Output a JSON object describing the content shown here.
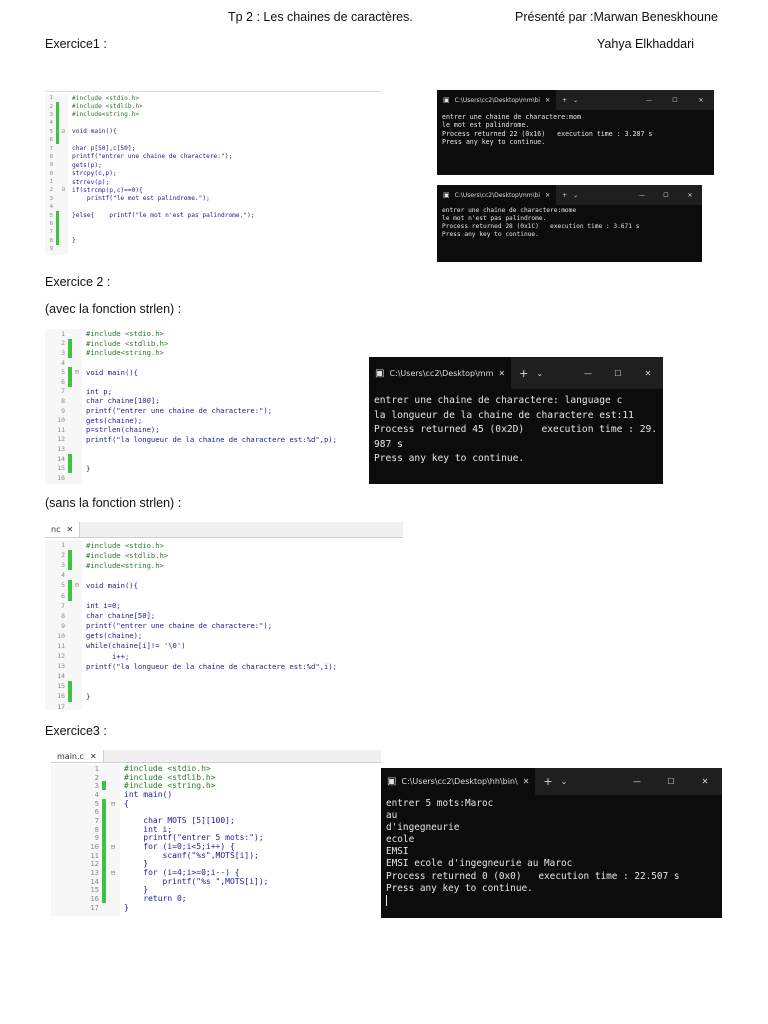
{
  "header": {
    "title": "Tp 2 : Les chaines de caractères.",
    "presented_by": "Présenté par :Marwan Beneskhoune",
    "second_author": "Yahya Elkhaddari"
  },
  "sections": {
    "ex1": "Exercice1 :",
    "ex2": "Exercice 2 :",
    "ex2_with": "(avec la fonction strlen) :",
    "ex2_without": "(sans la fonction strlen) :",
    "ex3": "Exercice3 :"
  },
  "editors": {
    "ex1": {
      "lines": [
        {
          "n": "1",
          "code": "#include <stdio.h>",
          "pp": true,
          "bar": false,
          "fold": ""
        },
        {
          "n": "2",
          "code": "#include <stdlib.h>",
          "pp": true,
          "bar": true,
          "fold": ""
        },
        {
          "n": "3",
          "code": "#include<string.h>",
          "pp": true,
          "bar": true,
          "fold": ""
        },
        {
          "n": "4",
          "code": "",
          "bar": true,
          "fold": ""
        },
        {
          "n": "5",
          "code": "void main(){",
          "bar": true,
          "fold": "⊟"
        },
        {
          "n": "6",
          "code": "",
          "bar": true,
          "fold": ""
        },
        {
          "n": "7",
          "code": "char p[50],c[50];",
          "bar": false,
          "fold": ""
        },
        {
          "n": "8",
          "code": "printf(\"entrer une chaine de charactere:\");",
          "bar": false,
          "fold": ""
        },
        {
          "n": "9",
          "code": "gets(p);",
          "bar": false,
          "fold": ""
        },
        {
          "n": "0",
          "code": "strcpy(c,p);",
          "bar": false,
          "fold": ""
        },
        {
          "n": "1",
          "code": "strrev(p);",
          "bar": false,
          "fold": ""
        },
        {
          "n": "2",
          "code": "if(strcmp(p,c)==0){",
          "bar": false,
          "fold": "⊟"
        },
        {
          "n": "3",
          "code": "    printf(\"le mot est palindrome.\");",
          "bar": false,
          "fold": ""
        },
        {
          "n": "4",
          "code": "",
          "bar": false,
          "fold": ""
        },
        {
          "n": "5",
          "code": "}else{    printf(\"le mot n'est pas palindrome.\");",
          "bar": true,
          "fold": ""
        },
        {
          "n": "6",
          "code": "",
          "bar": true,
          "fold": ""
        },
        {
          "n": "7",
          "code": "",
          "bar": true,
          "fold": ""
        },
        {
          "n": "8",
          "code": "}",
          "bar": true,
          "fold": ""
        },
        {
          "n": "9",
          "code": "",
          "bar": false,
          "fold": ""
        }
      ]
    },
    "ex2a": {
      "lines": [
        {
          "n": "1",
          "code": "#include <stdio.h>",
          "pp": true,
          "bar": false,
          "fold": ""
        },
        {
          "n": "2",
          "code": "#include <stdlib.h>",
          "pp": true,
          "bar": true,
          "fold": ""
        },
        {
          "n": "3",
          "code": "#include<string.h>",
          "pp": true,
          "bar": true,
          "fold": ""
        },
        {
          "n": "4",
          "code": "",
          "bar": false,
          "fold": ""
        },
        {
          "n": "5",
          "code": "void main(){",
          "bar": true,
          "fold": "⊟"
        },
        {
          "n": "6",
          "code": "",
          "bar": true,
          "fold": ""
        },
        {
          "n": "7",
          "code": "int p;",
          "bar": false,
          "fold": ""
        },
        {
          "n": "8",
          "code": "char chaine[100];",
          "bar": false,
          "fold": ""
        },
        {
          "n": "9",
          "code": "printf(\"entrer une chaine de charactere:\");",
          "bar": false,
          "fold": ""
        },
        {
          "n": "10",
          "code": "gets(chaine);",
          "bar": false,
          "fold": ""
        },
        {
          "n": "11",
          "code": "p=strlen(chaine);",
          "bar": false,
          "fold": ""
        },
        {
          "n": "12",
          "code": "printf(\"la longueur de la chaine de charactere est:%d\",p);",
          "bar": false,
          "fold": ""
        },
        {
          "n": "13",
          "code": "",
          "bar": false,
          "fold": ""
        },
        {
          "n": "14",
          "code": "",
          "bar": true,
          "fold": ""
        },
        {
          "n": "15",
          "code": "}",
          "bar": true,
          "fold": ""
        },
        {
          "n": "16",
          "code": "",
          "bar": false,
          "fold": ""
        }
      ]
    },
    "ex2b": {
      "tab": "nc",
      "lines": [
        {
          "n": "1",
          "code": "#include <stdio.h>",
          "pp": true,
          "bar": false,
          "fold": ""
        },
        {
          "n": "2",
          "code": "#include <stdlib.h>",
          "pp": true,
          "bar": true,
          "fold": ""
        },
        {
          "n": "3",
          "code": "#include<string.h>",
          "pp": true,
          "bar": true,
          "fold": ""
        },
        {
          "n": "4",
          "code": "",
          "bar": false,
          "fold": ""
        },
        {
          "n": "5",
          "code": "void main(){",
          "bar": true,
          "fold": "⊟"
        },
        {
          "n": "6",
          "code": "",
          "bar": true,
          "fold": ""
        },
        {
          "n": "7",
          "code": "int i=0;",
          "bar": false,
          "fold": ""
        },
        {
          "n": "8",
          "code": "char chaine[50];",
          "bar": false,
          "fold": ""
        },
        {
          "n": "9",
          "code": "printf(\"entrer une chaine de charactere:\");",
          "bar": false,
          "fold": ""
        },
        {
          "n": "10",
          "code": "gets(chaine);",
          "bar": false,
          "fold": ""
        },
        {
          "n": "11",
          "code": "while(chaine[i]!= '\\0')",
          "bar": false,
          "fold": ""
        },
        {
          "n": "12",
          "code": "      i++;",
          "bar": false,
          "fold": ""
        },
        {
          "n": "13",
          "code": "printf(\"la longueur de la chaine de charactere est:%d\",i);",
          "bar": false,
          "fold": ""
        },
        {
          "n": "14",
          "code": "",
          "bar": false,
          "fold": ""
        },
        {
          "n": "15",
          "code": "",
          "bar": true,
          "fold": ""
        },
        {
          "n": "16",
          "code": "}",
          "bar": true,
          "fold": ""
        },
        {
          "n": "17",
          "code": "",
          "bar": false,
          "fold": ""
        }
      ]
    },
    "ex3": {
      "tab": "main.c",
      "lines": [
        {
          "n": "1",
          "code": "#include <stdio.h>",
          "pp": true,
          "bar": false,
          "fold": ""
        },
        {
          "n": "2",
          "code": "#include <stdlib.h>",
          "pp": true,
          "bar": false,
          "fold": ""
        },
        {
          "n": "3",
          "code": "#include <string.h>",
          "pp": true,
          "bar": true,
          "fold": ""
        },
        {
          "n": "4",
          "code": "int main()",
          "bar": false,
          "fold": ""
        },
        {
          "n": "5",
          "code": "{",
          "bar": true,
          "fold": "⊟"
        },
        {
          "n": "6",
          "code": "",
          "bar": true,
          "fold": ""
        },
        {
          "n": "7",
          "code": "    char MOTS [5][100];",
          "bar": true,
          "fold": ""
        },
        {
          "n": "8",
          "code": "    int i;",
          "bar": true,
          "fold": ""
        },
        {
          "n": "9",
          "code": "    printf(\"entrer 5 mots:\");",
          "bar": true,
          "fold": ""
        },
        {
          "n": "10",
          "code": "    for (i=0;i<5;i++) {",
          "bar": true,
          "fold": "⊟"
        },
        {
          "n": "11",
          "code": "        scanf(\"%s\",MOTS[i]);",
          "bar": true,
          "fold": ""
        },
        {
          "n": "12",
          "code": "    }",
          "bar": true,
          "fold": ""
        },
        {
          "n": "13",
          "code": "    for (i=4;i>=0;i--) {",
          "bar": true,
          "fold": "⊟"
        },
        {
          "n": "14",
          "code": "        printf(\"%s \",MOTS[i]);",
          "bar": true,
          "fold": ""
        },
        {
          "n": "15",
          "code": "    }",
          "bar": true,
          "fold": ""
        },
        {
          "n": "16",
          "code": "    return 0;",
          "bar": true,
          "fold": ""
        },
        {
          "n": "17",
          "code": "}",
          "bar": false,
          "fold": ""
        }
      ]
    }
  },
  "terminals": {
    "t1": {
      "title": "C:\\Users\\cc2\\Desktop\\mm\\bi",
      "lines": [
        "entrer une chaine de charactere:mom",
        "le mot est palindrome.",
        "Process returned 22 (0x16)   execution time : 3.287 s",
        "Press any key to continue."
      ]
    },
    "t2": {
      "title": "C:\\Users\\cc2\\Desktop\\mm\\bi",
      "lines": [
        "entrer une chaine de charactere:mome",
        "le mot n'est pas palindrome.",
        "Process returned 28 (0x1C)   execution time : 3.671 s",
        "Press any key to continue."
      ]
    },
    "t3": {
      "title": "C:\\Users\\cc2\\Desktop\\mm",
      "lines": [
        "entrer une chaine de charactere: language c",
        "la longueur de la chaine de charactere est:11",
        "Process returned 45 (0x2D)   execution time : 29.",
        "987 s",
        "Press any key to continue."
      ]
    },
    "t4": {
      "title": "C:\\Users\\cc2\\Desktop\\hh\\bin\\",
      "lines": [
        "entrer 5 mots:Maroc",
        "au",
        "d'ingegneurie",
        "ecole",
        "EMSI",
        "EMSI ecole d'ingegneurie au Maroc",
        "Process returned 0 (0x0)   execution time : 22.507 s",
        "Press any key to continue."
      ]
    }
  },
  "icons": {
    "terminal": "terminal-app-icon",
    "close": "close-icon",
    "plus": "new-tab-icon",
    "chevron": "chevron-down-icon",
    "minimize": "minimize-icon",
    "maximize": "maximize-icon"
  },
  "colors": {
    "change_bar": "#3fc33f",
    "terminal_bg": "#0c0c0c",
    "code_text": "#1a1a9c"
  }
}
